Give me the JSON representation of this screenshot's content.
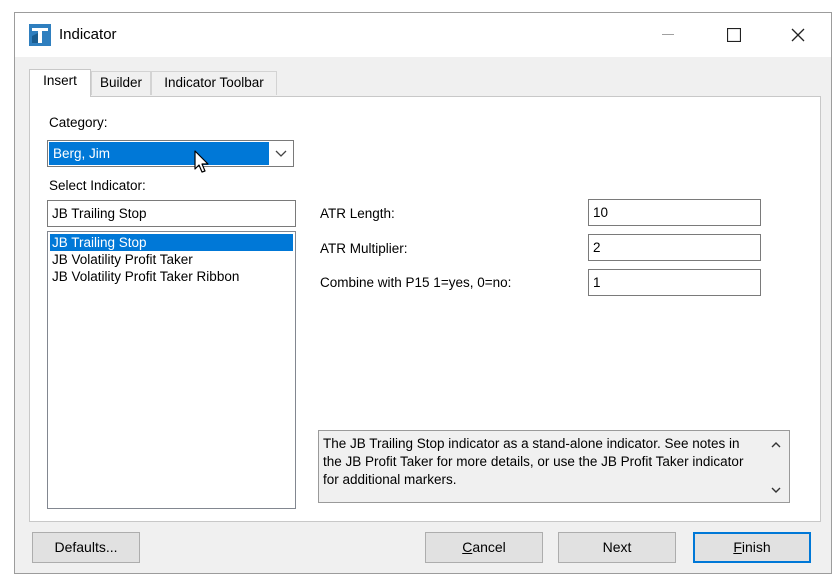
{
  "window": {
    "title": "Indicator"
  },
  "tabs": [
    {
      "label": "Insert",
      "active": true
    },
    {
      "label": "Builder",
      "active": false
    },
    {
      "label": "Indicator Toolbar",
      "active": false
    }
  ],
  "category": {
    "label": "Category:",
    "selected": "Berg, Jim"
  },
  "select_indicator": {
    "label": "Select Indicator:",
    "search_value": "JB Trailing Stop",
    "items": [
      {
        "label": "JB Trailing Stop",
        "selected": true
      },
      {
        "label": "JB Volatility Profit Taker",
        "selected": false
      },
      {
        "label": "JB Volatility Profit Taker Ribbon",
        "selected": false
      }
    ]
  },
  "params": [
    {
      "label": "ATR Length:",
      "value": "10"
    },
    {
      "label": "ATR Multiplier:",
      "value": "2"
    },
    {
      "label": "Combine with P15 1=yes, 0=no:",
      "value": "1"
    }
  ],
  "description": "The JB Trailing Stop indicator as a stand-alone indicator. See notes in the JB Profit Taker for more details, or use the JB Profit Taker indicator for additional markers.",
  "buttons": {
    "defaults": "Defaults...",
    "cancel_first": "C",
    "cancel_rest": "ancel",
    "next": "Next",
    "finish_first": "F",
    "finish_rest": "inish"
  },
  "colors": {
    "selection": "#0078d7",
    "dialog_bg": "#f0f0f0"
  },
  "icons": {
    "app": "indicator-app-icon",
    "minimize": "minimize-icon",
    "maximize": "maximize-icon",
    "close": "close-icon",
    "dropdown": "chevron-down-icon",
    "scroll_up": "chevron-up-icon",
    "scroll_down": "chevron-down-icon",
    "cursor": "mouse-pointer-icon"
  }
}
